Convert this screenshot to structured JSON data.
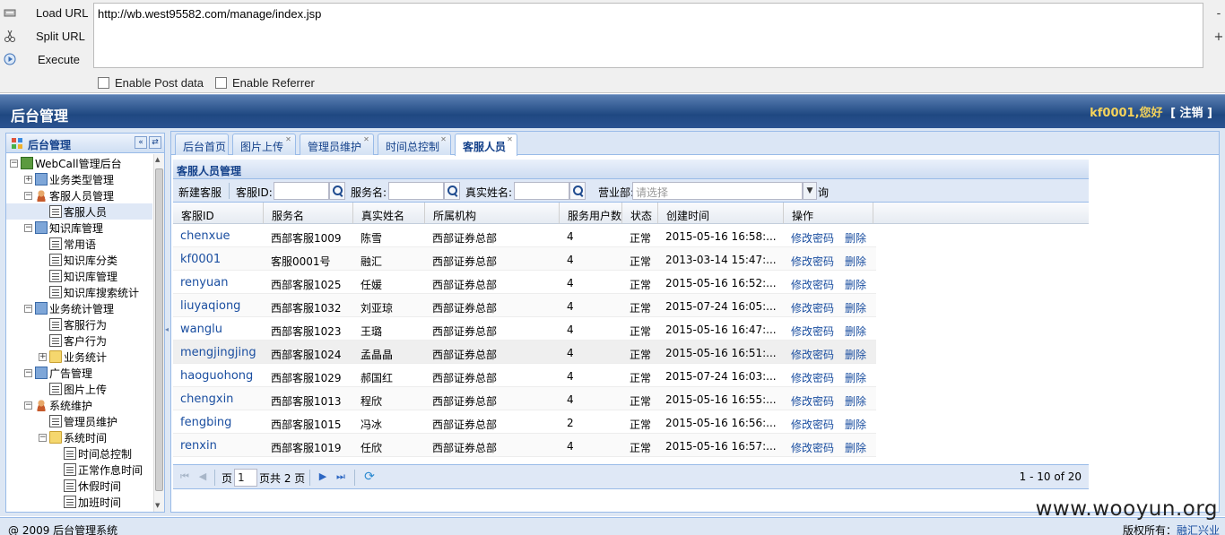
{
  "hackbar": {
    "load_url": "Load URL",
    "split_url": "Split URL",
    "execute": "Execute",
    "url_value": "http://wb.west95582.com/manage/index.jsp",
    "enable_post": "Enable Post data",
    "enable_referrer": "Enable Referrer",
    "minus": "-",
    "plus": "+"
  },
  "header": {
    "title": "后台管理",
    "welcome": "kf0001,您好",
    "logout": "[ 注销 ]"
  },
  "left_panel": {
    "title": "后台管理",
    "collapse_icon": "«",
    "refresh_icon": "⇄",
    "tree": [
      {
        "label": "WebCall管理后台",
        "exp": "−"
      },
      {
        "label": "业务类型管理",
        "exp": "+"
      },
      {
        "label": "客服人员管理",
        "exp": "−"
      },
      {
        "label": "客服人员"
      },
      {
        "label": "知识库管理",
        "exp": "−"
      },
      {
        "label": "常用语"
      },
      {
        "label": "知识库分类"
      },
      {
        "label": "知识库管理"
      },
      {
        "label": "知识库搜索统计"
      },
      {
        "label": "业务统计管理",
        "exp": "−"
      },
      {
        "label": "客服行为"
      },
      {
        "label": "客户行为"
      },
      {
        "label": "业务统计",
        "exp": "+"
      },
      {
        "label": "广告管理",
        "exp": "−"
      },
      {
        "label": "图片上传"
      },
      {
        "label": "系统维护",
        "exp": "−"
      },
      {
        "label": "管理员维护"
      },
      {
        "label": "系统时间",
        "exp": "−"
      },
      {
        "label": "时间总控制"
      },
      {
        "label": "正常作息时间"
      },
      {
        "label": "休假时间"
      },
      {
        "label": "加班时间"
      }
    ]
  },
  "tabs": [
    {
      "label": "后台首页"
    },
    {
      "label": "图片上传"
    },
    {
      "label": "管理员维护"
    },
    {
      "label": "时间总控制"
    },
    {
      "label": "客服人员"
    }
  ],
  "content": {
    "title": "客服人员管理",
    "toolbar": {
      "new_label": "新建客服",
      "id_label": "客服ID:",
      "name_label": "服务名:",
      "realname_label": "真实姓名:",
      "dept_label": "营业部:",
      "dept_placeholder": "请选择",
      "query_tail": "询"
    },
    "columns": [
      "客服ID",
      "服务名",
      "真实姓名",
      "所属机构",
      "服务用户数",
      "状态",
      "创建时间",
      "操作"
    ],
    "rows": [
      {
        "id": "chenxue",
        "service": "西部客服1009",
        "name": "陈雪",
        "org": "西部证券总部",
        "users": "4",
        "status": "正常",
        "created": "2015-05-16 16:58:..."
      },
      {
        "id": "kf0001",
        "service": "客服0001号",
        "name": "融汇",
        "org": "西部证券总部",
        "users": "4",
        "status": "正常",
        "created": "2013-03-14 15:47:..."
      },
      {
        "id": "renyuan",
        "service": "西部客服1025",
        "name": "任媛",
        "org": "西部证券总部",
        "users": "4",
        "status": "正常",
        "created": "2015-05-16 16:52:..."
      },
      {
        "id": "liuyaqiong",
        "service": "西部客服1032",
        "name": "刘亚琼",
        "org": "西部证券总部",
        "users": "4",
        "status": "正常",
        "created": "2015-07-24 16:05:..."
      },
      {
        "id": "wanglu",
        "service": "西部客服1023",
        "name": "王璐",
        "org": "西部证券总部",
        "users": "4",
        "status": "正常",
        "created": "2015-05-16 16:47:..."
      },
      {
        "id": "mengjingjing",
        "service": "西部客服1024",
        "name": "孟晶晶",
        "org": "西部证券总部",
        "users": "4",
        "status": "正常",
        "created": "2015-05-16 16:51:..."
      },
      {
        "id": "haoguohong",
        "service": "西部客服1029",
        "name": "郝国红",
        "org": "西部证券总部",
        "users": "4",
        "status": "正常",
        "created": "2015-07-24 16:03:..."
      },
      {
        "id": "chengxin",
        "service": "西部客服1013",
        "name": "程欣",
        "org": "西部证券总部",
        "users": "4",
        "status": "正常",
        "created": "2015-05-16 16:55:..."
      },
      {
        "id": "fengbing",
        "service": "西部客服1015",
        "name": "冯冰",
        "org": "西部证券总部",
        "users": "2",
        "status": "正常",
        "created": "2015-05-16 16:56:..."
      },
      {
        "id": "renxin",
        "service": "西部客服1019",
        "name": "任欣",
        "org": "西部证券总部",
        "users": "4",
        "status": "正常",
        "created": "2015-05-16 16:57:..."
      }
    ],
    "action_edit": "修改密码",
    "action_delete": "删除"
  },
  "pager": {
    "page_prefix": "页",
    "page_value": "1",
    "page_suffix": "页共 2 页",
    "summary": "1 - 10 of 20"
  },
  "footer": {
    "copyright": "@ 2009 后台管理系统",
    "rights_label": "版权所有：",
    "rights_owner": "融汇兴业"
  },
  "watermark": "www.wooyun.org"
}
